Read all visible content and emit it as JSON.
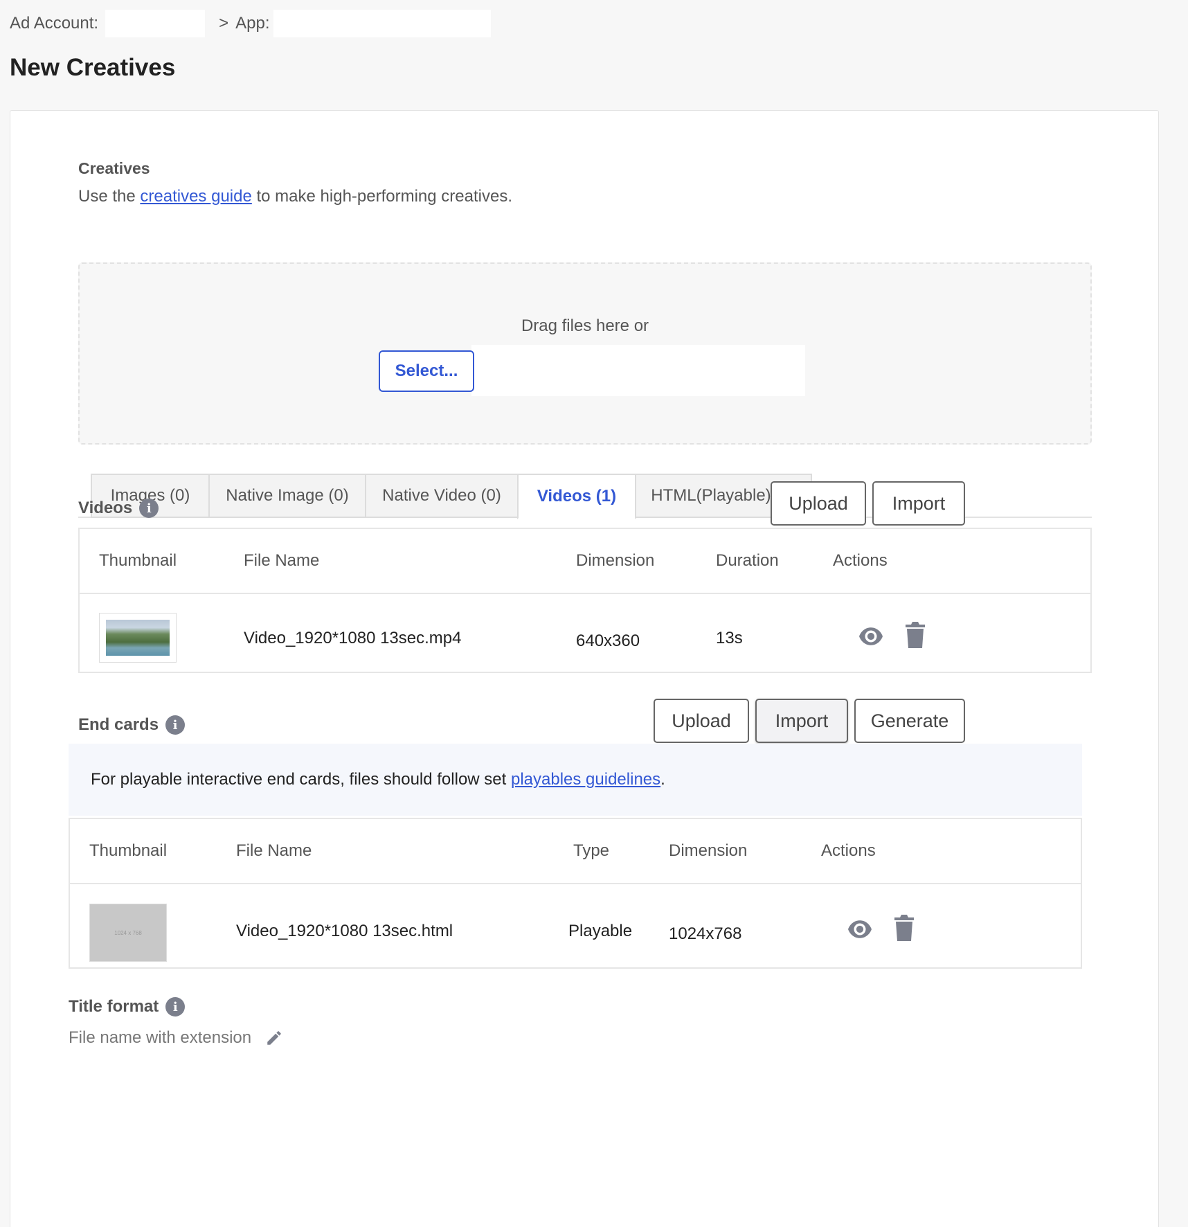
{
  "breadcrumb": {
    "ad_account_label": "Ad Account:",
    "separator": ">",
    "app_label": "App:"
  },
  "page_title": "New Creatives",
  "creatives": {
    "label": "Creatives",
    "desc_before": "Use the",
    "desc_link": "creatives guide",
    "desc_after": "to make high-performing creatives."
  },
  "dropzone": {
    "hint": "Drag files here or",
    "select_label": "Select..."
  },
  "tabs": [
    {
      "label": "Images (0)"
    },
    {
      "label": "Native Image (0)"
    },
    {
      "label": "Native Video (0)"
    },
    {
      "label": "Videos (1)"
    },
    {
      "label": "HTML(Playable) (0)"
    }
  ],
  "videos": {
    "label": "Videos",
    "upload_label": "Upload",
    "import_label": "Import",
    "columns": [
      "Thumbnail",
      "File Name",
      "Dimension",
      "Duration",
      "Actions"
    ],
    "rows": [
      {
        "file_name": "Video_1920*1080 13sec.mp4",
        "dimension": "640x360",
        "duration": "13s"
      }
    ]
  },
  "end_cards": {
    "label": "End cards",
    "upload_label": "Upload",
    "import_label": "Import",
    "generate_label": "Generate",
    "notice_before": "For playable interactive end cards, files should follow set",
    "notice_link": "playables guidelines",
    "notice_after": ".",
    "columns": [
      "Thumbnail",
      "File Name",
      "Type",
      "Dimension",
      "Actions"
    ],
    "rows": [
      {
        "thumb_text": "1024 x 768",
        "file_name": "Video_1920*1080 13sec.html",
        "type": "Playable",
        "dimension": "1024x768"
      }
    ]
  },
  "title_format": {
    "label": "Title format",
    "value": "File name with extension"
  },
  "icons": {
    "info": "info-icon",
    "view": "eye-icon",
    "delete": "trash-icon",
    "edit": "pencil-icon"
  },
  "colors": {
    "accent": "#3358d4",
    "icon_gray": "#7b7f8c"
  }
}
